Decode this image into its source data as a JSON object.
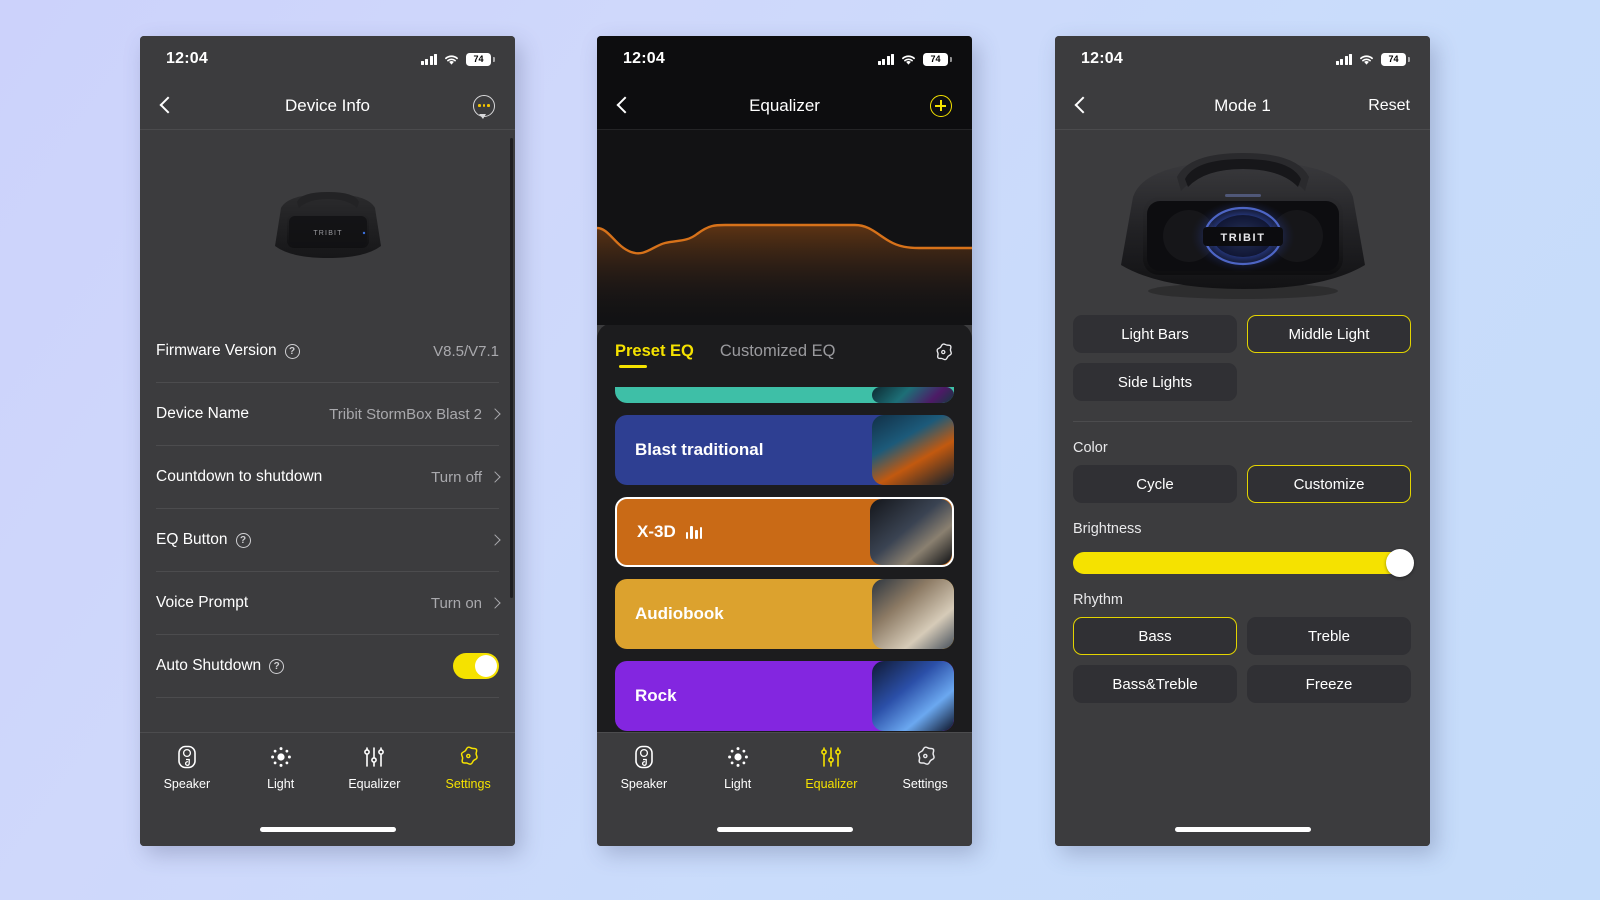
{
  "colors": {
    "accent_yellow": "#f5e200",
    "panel_grey": "#3c3c3e",
    "panel_dark": "#1c1c1e",
    "eq_orange": "#d7721a",
    "bg_from": "#ccd2fb",
    "bg_to": "#c5dcfa"
  },
  "status": {
    "time": "12:04",
    "battery": "74",
    "signal_icon": "cellular-bars-icon",
    "wifi_icon": "wifi-icon",
    "battery_icon": "battery-icon"
  },
  "phone1": {
    "nav": {
      "back_icon": "chevron-left-icon",
      "title": "Device Info",
      "right_icon": "chat-bubble-icon"
    },
    "hero_alt": "Tribit StormBox Blast 2 speaker",
    "rows": [
      {
        "label": "Firmware Version",
        "help": true,
        "value": "V8.5/V7.1",
        "chevron": false,
        "toggle": null
      },
      {
        "label": "Device Name",
        "help": false,
        "value": "Tribit StormBox Blast 2",
        "chevron": true,
        "toggle": null
      },
      {
        "label": "Countdown to shutdown",
        "help": false,
        "value": "Turn off",
        "chevron": true,
        "toggle": null
      },
      {
        "label": "EQ Button",
        "help": true,
        "value": "",
        "chevron": true,
        "toggle": null
      },
      {
        "label": "Voice Prompt",
        "help": false,
        "value": "Turn on",
        "chevron": true,
        "toggle": null
      },
      {
        "label": "Auto Shutdown",
        "help": true,
        "value": "",
        "chevron": false,
        "toggle": "on"
      }
    ],
    "tabs": [
      {
        "label": "Speaker",
        "icon": "speaker-icon",
        "active": false
      },
      {
        "label": "Light",
        "icon": "light-sun-icon",
        "active": false
      },
      {
        "label": "Equalizer",
        "icon": "equalizer-sliders-icon",
        "active": false
      },
      {
        "label": "Settings",
        "icon": "settings-gear-icon",
        "active": true
      }
    ]
  },
  "phone2": {
    "nav": {
      "back_icon": "chevron-left-icon",
      "title": "Equalizer",
      "right_icon": "plus-circle-icon"
    },
    "eq_curve_label": "equalizer-response-curve",
    "tabs": [
      {
        "label": "Preset EQ",
        "active": true
      },
      {
        "label": "Customized EQ",
        "active": false
      }
    ],
    "settings_icon": "gear-icon",
    "presets": [
      {
        "name": "",
        "color": "#3ebfa7",
        "selected": false,
        "partial": true
      },
      {
        "name": "Blast traditional",
        "color": "#2e3f92",
        "selected": false,
        "partial": false
      },
      {
        "name": "X-3D",
        "color": "#c96a16",
        "selected": true,
        "partial": false,
        "badge_icon": "eq-bars-icon"
      },
      {
        "name": "Audiobook",
        "color": "#dca22e",
        "selected": false,
        "partial": false
      },
      {
        "name": "Rock",
        "color": "#8326e0",
        "selected": false,
        "partial": false
      }
    ],
    "tabs_bottom": [
      {
        "label": "Speaker",
        "icon": "speaker-icon",
        "active": false
      },
      {
        "label": "Light",
        "icon": "light-sun-icon",
        "active": false
      },
      {
        "label": "Equalizer",
        "icon": "equalizer-sliders-icon",
        "active": true
      },
      {
        "label": "Settings",
        "icon": "settings-gear-icon",
        "active": false
      }
    ]
  },
  "phone3": {
    "nav": {
      "back_icon": "chevron-left-icon",
      "title": "Mode 1",
      "right_label": "Reset"
    },
    "hero_alt": "Tribit StormBox Blast 2 speaker with blue light",
    "zones": [
      {
        "label": "Light Bars",
        "selected": false
      },
      {
        "label": "Middle Light",
        "selected": true
      },
      {
        "label": "Side Lights",
        "selected": false
      }
    ],
    "color_section": {
      "label": "Color",
      "options": [
        {
          "label": "Cycle",
          "selected": false
        },
        {
          "label": "Customize",
          "selected": true
        }
      ]
    },
    "brightness_section": {
      "label": "Brightness",
      "value": 100
    },
    "rhythm_section": {
      "label": "Rhythm",
      "options": [
        {
          "label": "Bass",
          "selected": true
        },
        {
          "label": "Treble",
          "selected": false
        },
        {
          "label": "Bass&Treble",
          "selected": false
        },
        {
          "label": "Freeze",
          "selected": false
        }
      ]
    }
  }
}
